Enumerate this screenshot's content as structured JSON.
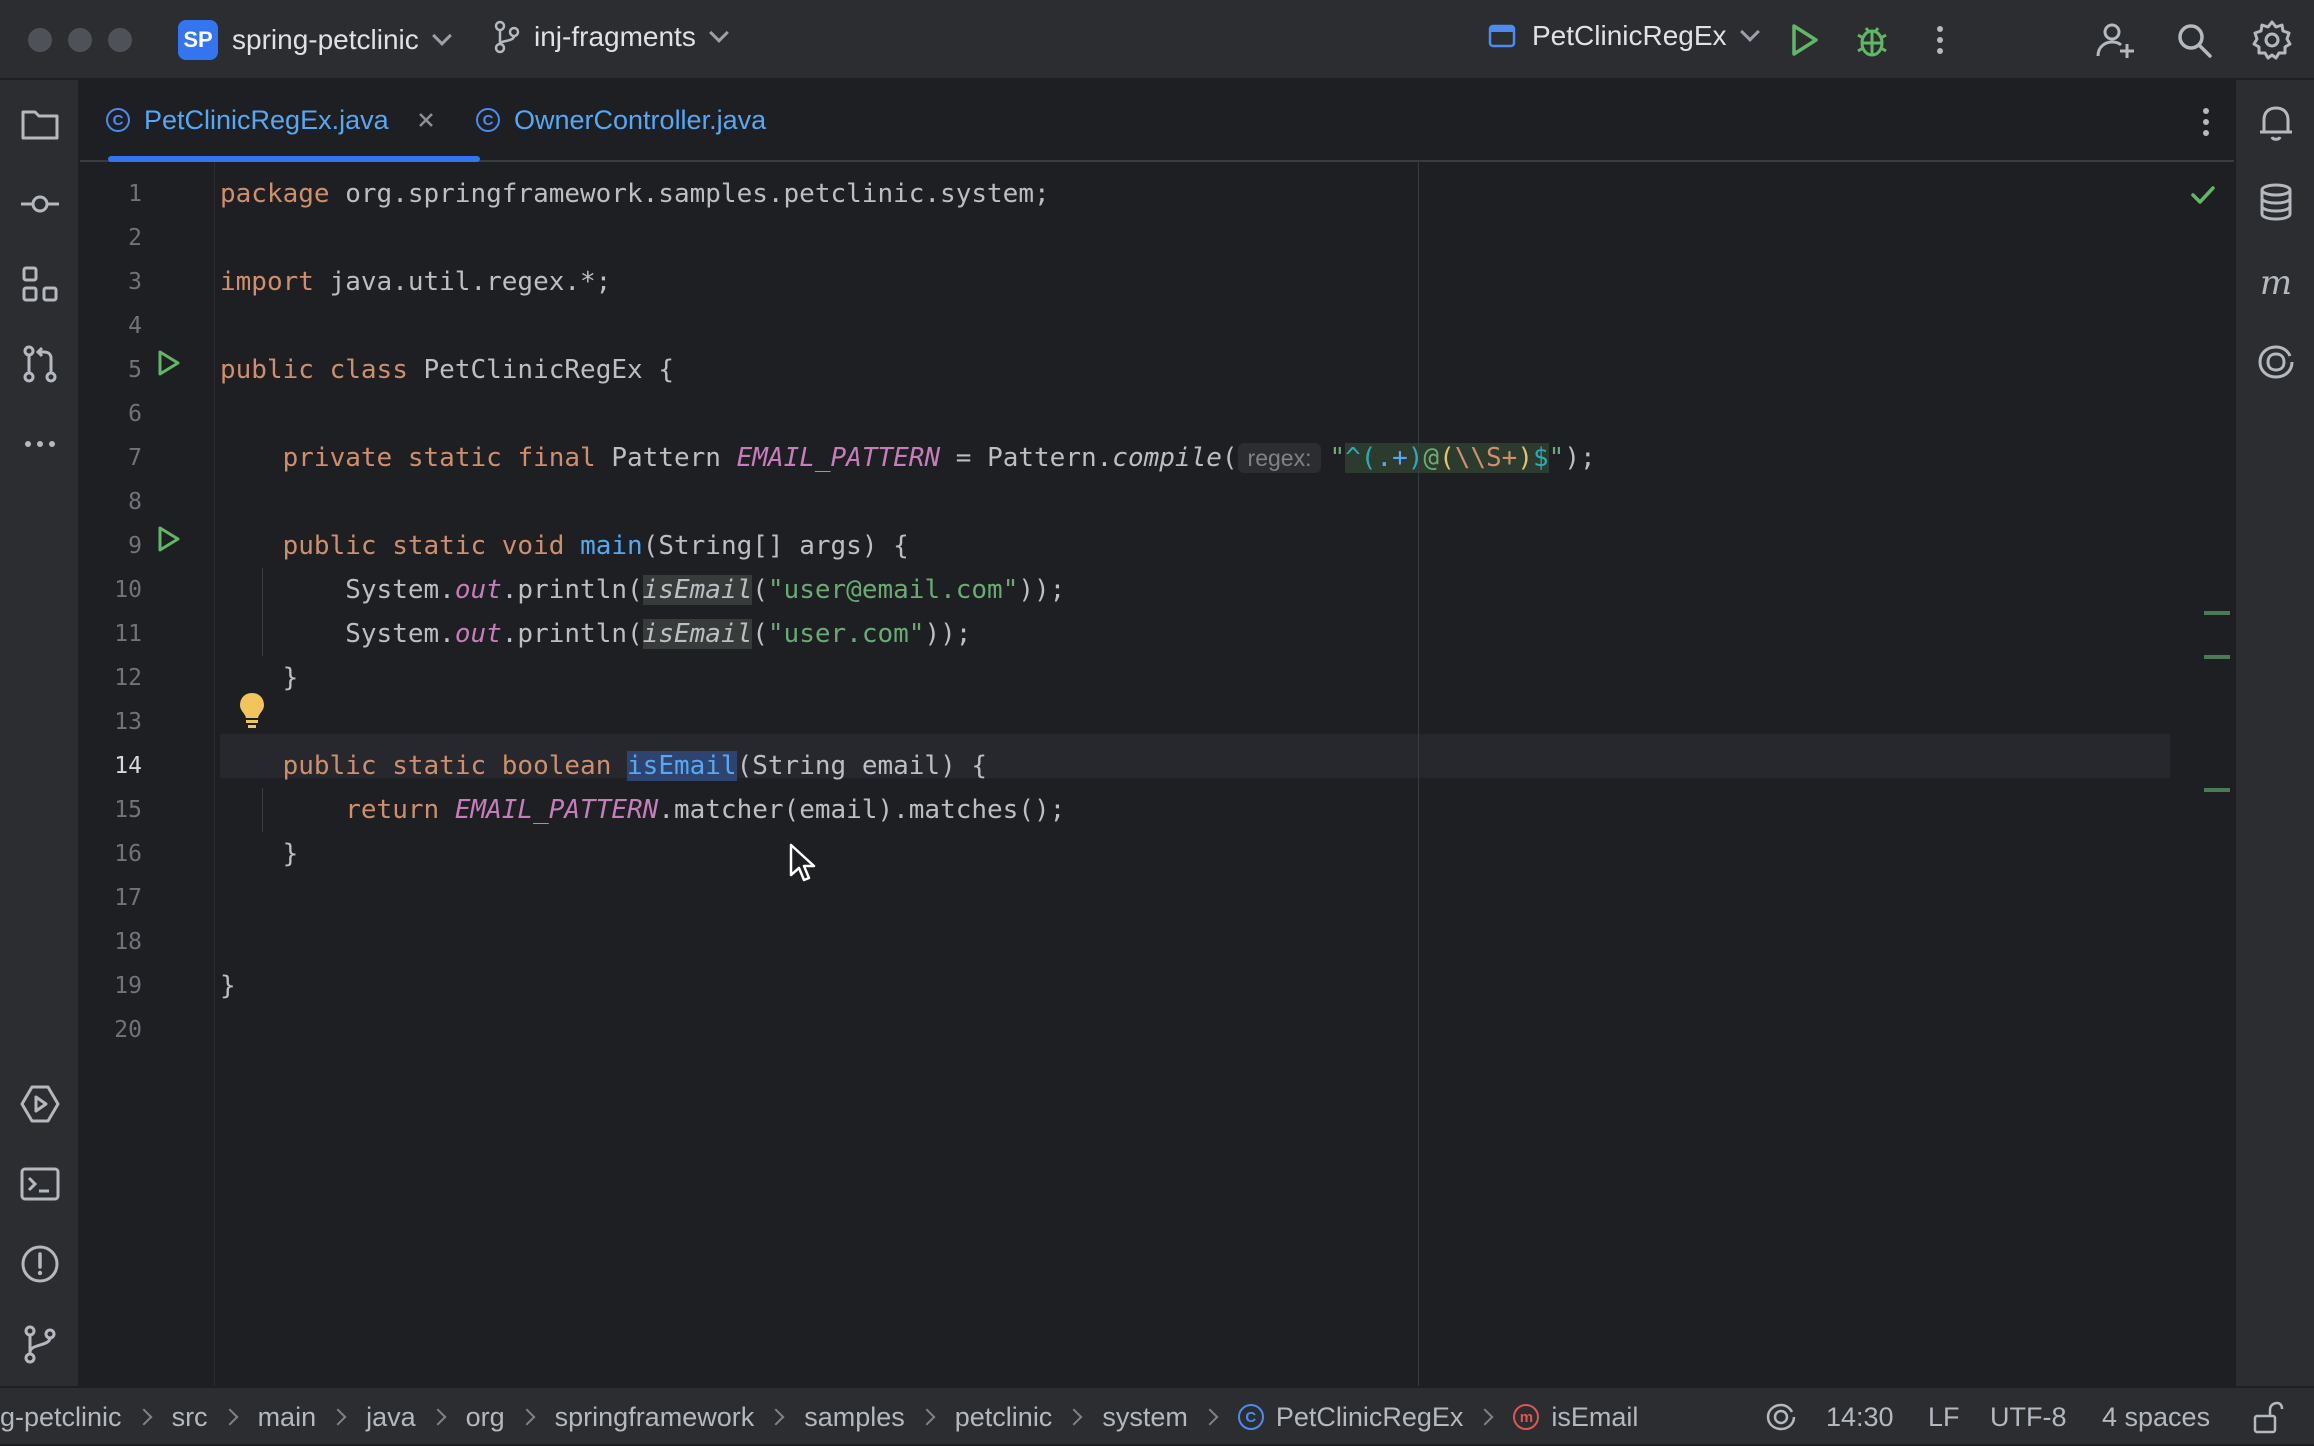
{
  "titlebar": {
    "project_badge": "SP",
    "project_name": "spring-petclinic",
    "branch": "inj-fragments",
    "run_config": "PetClinicRegEx"
  },
  "tabs": [
    {
      "label": "PetClinicRegEx.java",
      "active": true
    },
    {
      "label": "OwnerController.java",
      "active": false
    }
  ],
  "editor": {
    "current_line": 14,
    "line_numbers": [
      "1",
      "2",
      "3",
      "4",
      "5",
      "6",
      "7",
      "8",
      "9",
      "10",
      "11",
      "12",
      "13",
      "14",
      "15",
      "16",
      "17",
      "18",
      "19",
      "20"
    ],
    "lines": {
      "l1": {
        "kw": "package",
        "rest": " org.springframework.samples.petclinic.system;"
      },
      "l3": {
        "kw": "import",
        "rest": " java.util.regex.*;"
      },
      "l5": {
        "kw1": "public",
        "kw2": "class",
        "rest": " PetClinicRegEx {"
      },
      "l7": {
        "kw1": "private",
        "kw2": "static",
        "kw3": "final",
        "type": " Pattern ",
        "const": "EMAIL_PATTERN",
        "eq": " = Pattern.",
        "method": "compile",
        "paren": "(",
        "hint": "regex:",
        "q1": "\"",
        "rx_a": "^(",
        "rx_b": ".+",
        "rx_c": ")",
        "rx_d": "@",
        "rx_e": "(",
        "rx_f": "\\\\S+",
        "rx_g": ")",
        "rx_h": "$",
        "q2": "\"",
        "end": ");"
      },
      "l9": {
        "kw1": "public",
        "kw2": "static",
        "kw3": "void",
        "fn": "main",
        "rest": "(String[] args) {"
      },
      "l10": {
        "pre": "System.",
        "out": "out",
        "mid": ".println(",
        "call": "isEmail",
        "open": "(",
        "str": "\"user@email.com\"",
        "end": "));"
      },
      "l11": {
        "pre": "System.",
        "out": "out",
        "mid": ".println(",
        "call": "isEmail",
        "open": "(",
        "str": "\"user.com\"",
        "end": "));"
      },
      "l12": {
        "text": "}"
      },
      "l14": {
        "kw1": "public",
        "kw2": "static",
        "kw3": "boolean",
        "fn": "isEmail",
        "rest": "(String email) {"
      },
      "l15": {
        "kw": "return",
        "const": "EMAIL_PATTERN",
        "rest": ".matcher(email).matches();"
      },
      "l16": {
        "text": "}"
      },
      "l19": {
        "text": "}"
      }
    }
  },
  "statusbar": {
    "breadcrumbs": [
      "g-petclinic",
      "src",
      "main",
      "java",
      "org",
      "springframework",
      "samples",
      "petclinic",
      "system"
    ],
    "class_crumb": "PetClinicRegEx",
    "method_crumb": "isEmail",
    "class_icon_letter": "C",
    "method_icon_letter": "m",
    "position": "14:30",
    "line_ending": "LF",
    "encoding": "UTF-8",
    "indent": "4 spaces"
  },
  "icons": {
    "left_strip": [
      "folder-icon",
      "commit-icon",
      "structure-icon",
      "pull-request-icon",
      "more-icon",
      "services-icon",
      "terminal-icon",
      "problems-icon",
      "git-icon"
    ],
    "right_strip": [
      "notifications-icon",
      "database-icon",
      "maven-icon",
      "ai-assistant-icon"
    ]
  },
  "colors": {
    "accent": "#3574f0",
    "keyword": "#cf8e6d",
    "string": "#6aab73",
    "function": "#56a8f5",
    "constant": "#c77dbb"
  }
}
